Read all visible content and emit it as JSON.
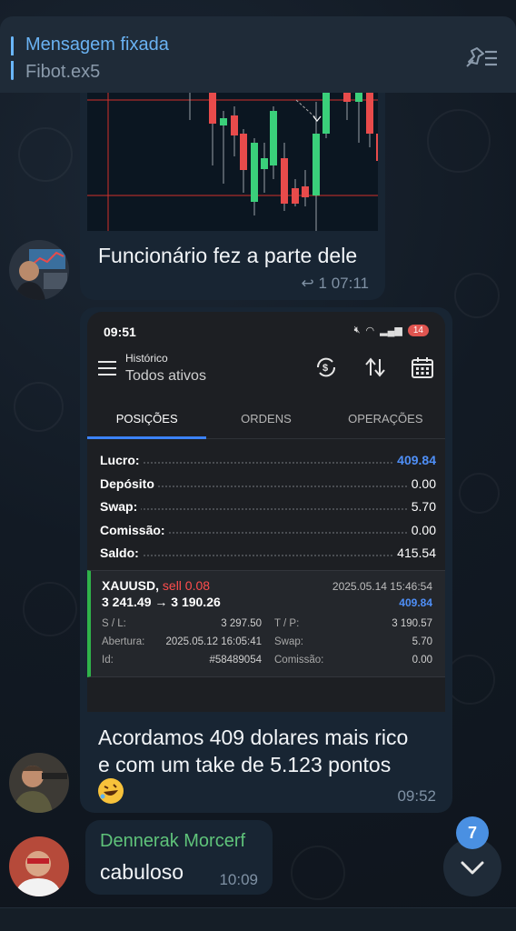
{
  "pinned": {
    "title": "Mensagem fixada",
    "subtitle": "Fibot.ex5",
    "unpin_icon": "pin-list-icon"
  },
  "message1": {
    "caption": "Funcionário fez a parte dele",
    "reply_count": "1",
    "time": "07:11",
    "reply_icon": "reply-arrow-icon"
  },
  "message2": {
    "phone": {
      "status_time": "09:51",
      "battery": "14",
      "app_title": "Histórico",
      "app_subtitle": "Todos ativos",
      "tabs": [
        "POSIÇÕES",
        "ORDENS",
        "OPERAÇÕES"
      ],
      "summary": [
        {
          "label": "Lucro:",
          "value": "409.84"
        },
        {
          "label": "Depósito",
          "value": "0.00"
        },
        {
          "label": "Swap:",
          "value": "5.70"
        },
        {
          "label": "Comissão:",
          "value": "0.00"
        },
        {
          "label": "Saldo:",
          "value": "415.54"
        }
      ],
      "trade": {
        "symbol": "XAUUSD,",
        "side": "sell 0.08",
        "prices": "3 241.49 → 3 190.26",
        "close_date": "2025.05.14 15:46:54",
        "profit": "409.84",
        "sl_label": "S / L:",
        "sl": "3 297.50",
        "tp_label": "T / P:",
        "tp": "3 190.57",
        "open_label": "Abertura:",
        "open": "2025.05.12 16:05:41",
        "swap_label": "Swap:",
        "swap": "5.70",
        "id_label": "Id:",
        "id": "#58489054",
        "commission_label": "Comissão:",
        "commission": "0.00"
      }
    },
    "caption_line1": "Acordamos 409 dolares mais rico",
    "caption_line2": "e com um take de 5.123 pontos",
    "emoji": "rolling-on-floor-laughing-emoji",
    "time": "09:52"
  },
  "message3": {
    "sender": "Dennerak Morcerf",
    "text": "cabuloso",
    "time": "10:09"
  },
  "scroll": {
    "unread_count": "7"
  },
  "colors": {
    "background": "#0e1621",
    "bubble": "#182533",
    "accent": "#6ab2f2",
    "sender": "#5fc37a",
    "profit": "#4f8ff7",
    "buy_bar": "#2fb34a",
    "sell": "#ff4d4d"
  }
}
